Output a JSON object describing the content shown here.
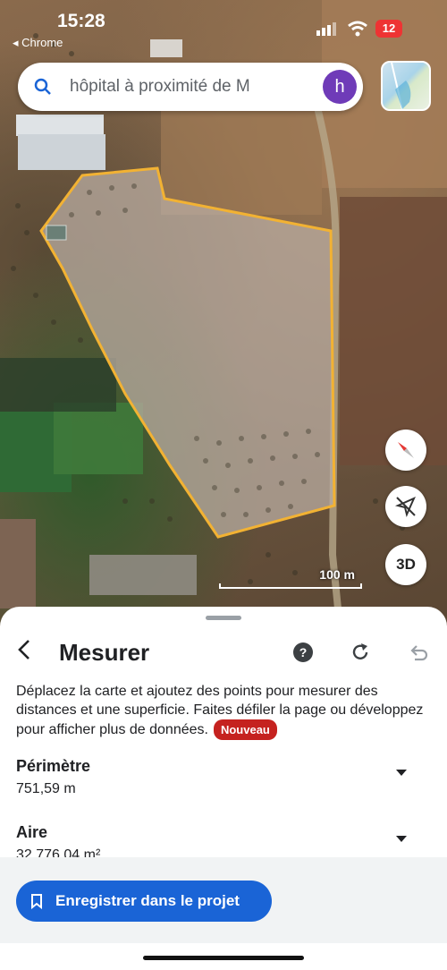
{
  "status_bar": {
    "time": "15:28",
    "back_app": "◂ Chrome",
    "battery": "12"
  },
  "search": {
    "query": "hôpital à proximité de M",
    "avatar_letter": "h",
    "icon": "search-icon"
  },
  "map": {
    "scale_label": "100 m",
    "btn_3d": "3D",
    "boundary_color": "#f2b233"
  },
  "sheet": {
    "title": "Mesurer",
    "description": "Déplacez la carte et ajoutez des points pour mesurer des distances et une superficie. Faites défiler la page ou développez pour afficher plus de données.",
    "badge": "Nouveau",
    "metrics": [
      {
        "label": "Périmètre",
        "value": "751,59 m"
      },
      {
        "label": "Aire",
        "value": "32 776,04 m²"
      }
    ],
    "save_label": "Enregistrer dans le projet"
  },
  "colors": {
    "accent": "#1a64d6",
    "badge": "#c5221f",
    "avatar": "#6f3bb8"
  }
}
